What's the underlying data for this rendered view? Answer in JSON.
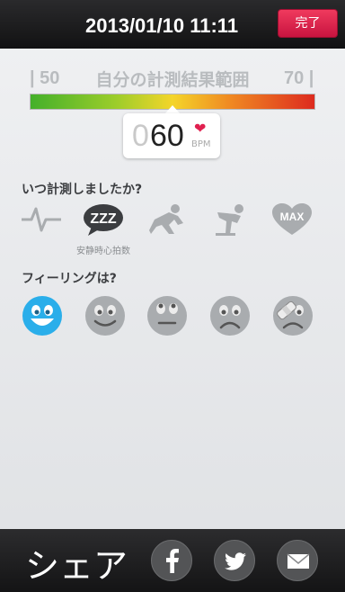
{
  "header": {
    "datetime": "2013/01/10 11:11",
    "done_label": "完了"
  },
  "range": {
    "title": "自分の計測結果範囲",
    "min_label": "| 50",
    "max_label": "70 |"
  },
  "reading": {
    "leading_zero": "0",
    "value": "60",
    "unit": "BPM"
  },
  "activity": {
    "question": "いつ計測しましたか?",
    "selected_label": "安静時心拍数",
    "options": [
      "pulse-icon",
      "resting-icon",
      "running-icon",
      "exercise-icon",
      "max-icon"
    ],
    "max_icon_text": "MAX",
    "resting_icon_text": "ZZZ"
  },
  "feeling": {
    "question": "フィーリングは?",
    "options": [
      "very-happy-face-icon",
      "smile-face-icon",
      "neutral-face-icon",
      "sad-face-icon",
      "hurt-face-icon"
    ]
  },
  "share": {
    "label": "シェア",
    "buttons": [
      "facebook-icon",
      "twitter-icon",
      "mail-icon"
    ]
  },
  "colors": {
    "accent": "#dd1c48",
    "selected_face": "#2aaeea",
    "inactive": "#a9acaf"
  }
}
